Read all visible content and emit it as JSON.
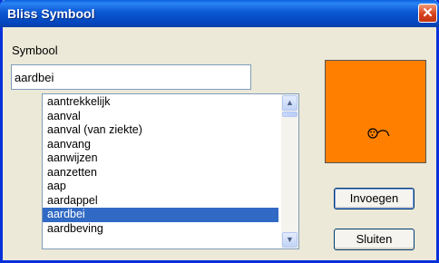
{
  "window": {
    "title": "Bliss Symbool",
    "close_glyph": "✕"
  },
  "form": {
    "symbol_label": "Symbool",
    "symbol_value": "aardbei"
  },
  "list": {
    "items": [
      "aantrekkelijk",
      "aanval",
      "aanval (van ziekte)",
      "aanvang",
      "aanwijzen",
      "aanzetten",
      "aap",
      "aardappel",
      "aardbei",
      "aardbeving"
    ],
    "selected": "aardbei"
  },
  "buttons": {
    "insert": "Invoegen",
    "close": "Sluiten"
  },
  "colors": {
    "preview_bg": "#ff8000",
    "selection": "#316ac5"
  }
}
